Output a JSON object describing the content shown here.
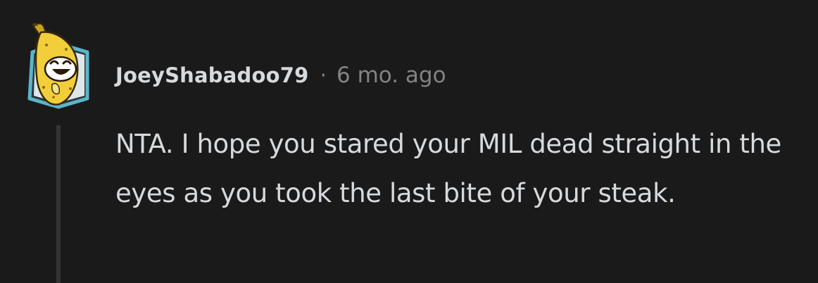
{
  "comment": {
    "author": "JoeyShabadoo79",
    "separator": "·",
    "timestamp": "6 mo. ago",
    "body": "NTA. I hope you stared your MIL dead straight in the eyes as you took the last bite of your steak.",
    "avatar_icon": "banana-avatar-icon"
  },
  "colors": {
    "background": "#1a1a1b",
    "text_primary": "#d7dadc",
    "text_muted": "#818384",
    "thread_line": "#343536",
    "avatar_frame": "#5bb5c9",
    "banana": "#f2cf3a"
  }
}
